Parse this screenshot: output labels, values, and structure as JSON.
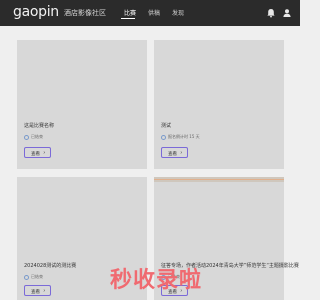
{
  "header": {
    "logo": "gaopin",
    "logo_suffix": "酒店影像社区",
    "nav": [
      "比赛",
      "供稿",
      "发现"
    ],
    "icons": [
      "bell-icon",
      "user-icon"
    ]
  },
  "cards": [
    {
      "title": "这是比赛名称",
      "meta": "已结束",
      "button": "查看"
    },
    {
      "title": "测试",
      "meta": "报名倒计时 15 天",
      "button": "查看"
    },
    {
      "title": "2024028测试的测比赛",
      "meta": "已结束",
      "button": "查看"
    },
    {
      "title": "征答专场，作者活动2024年青岛大学”师范学生“主题摄影比赛",
      "meta": "已结束",
      "button": "查看"
    }
  ],
  "watermark": "秒收录啦"
}
